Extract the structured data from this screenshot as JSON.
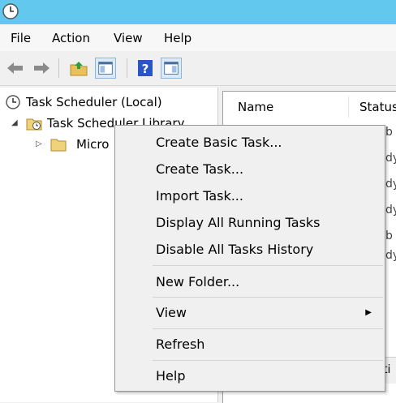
{
  "menu": [
    "File",
    "Action",
    "View",
    "Help"
  ],
  "tree": {
    "root": "Task Scheduler (Local)",
    "library": "Task Scheduler Library",
    "child": "Micro"
  },
  "list": {
    "columns": [
      "Name",
      "Status"
    ],
    "status_fragments": [
      "b",
      "dy",
      "dy",
      "dy",
      "b",
      "dy"
    ],
    "bottom_fragment": "ti"
  },
  "context_menu": [
    {
      "label": "Create Basic Task...",
      "submenu": false
    },
    {
      "label": "Create Task...",
      "submenu": false
    },
    {
      "label": "Import Task...",
      "submenu": false
    },
    {
      "label": "Display All Running Tasks",
      "submenu": false
    },
    {
      "label": "Disable All Tasks History",
      "submenu": false
    },
    {
      "label": "New Folder...",
      "submenu": false
    },
    {
      "label": "View",
      "submenu": true
    },
    {
      "label": "Refresh",
      "submenu": false
    },
    {
      "label": "Help",
      "submenu": false
    }
  ],
  "icons": {
    "app": "clock-icon",
    "back": "back-arrow-icon",
    "forward": "forward-arrow-icon",
    "up": "up-folder-icon",
    "console_tree": "console-tree-icon",
    "help": "help-icon",
    "action_pane": "action-pane-icon"
  },
  "colors": {
    "titlebar": "#62c8ee",
    "selection": "#cce8ff",
    "menu_bg": "#f0f0f0"
  }
}
